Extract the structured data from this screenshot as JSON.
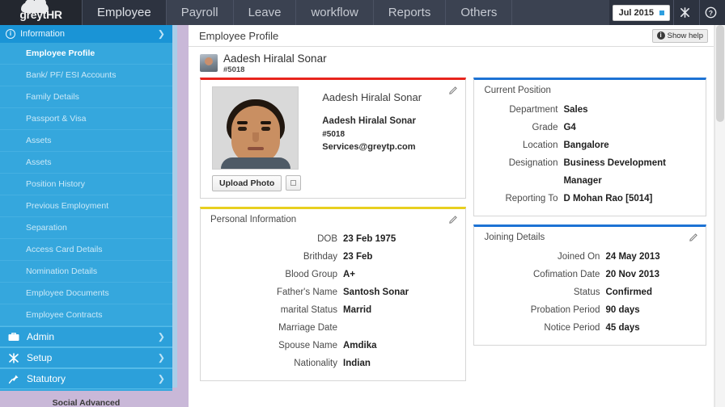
{
  "app": {
    "logo_grey": "greyt",
    "logo_hr": "HR"
  },
  "topnav": {
    "tabs": [
      {
        "label": "Employee",
        "active": true
      },
      {
        "label": "Payroll",
        "active": false
      },
      {
        "label": "Leave",
        "active": false
      },
      {
        "label": "workflow",
        "active": false
      },
      {
        "label": "Reports",
        "active": false
      },
      {
        "label": "Others",
        "active": false
      }
    ],
    "period": "Jul 2015",
    "tools_icon": "tools-icon",
    "help_icon": "help-circle-icon"
  },
  "sidebar": {
    "header": {
      "label": "Information",
      "icon": "info-circle-icon",
      "chevron": "chevron-right-icon"
    },
    "items": [
      {
        "label": "Employee Profile",
        "selected": true
      },
      {
        "label": "Bank/ PF/ ESI Accounts",
        "selected": false
      },
      {
        "label": "Family Details",
        "selected": false
      },
      {
        "label": "Passport & Visa",
        "selected": false
      },
      {
        "label": "Assets",
        "selected": false
      },
      {
        "label": "Assets",
        "selected": false
      },
      {
        "label": "Position History",
        "selected": false
      },
      {
        "label": "Previous Employment",
        "selected": false
      },
      {
        "label": "Separation",
        "selected": false
      },
      {
        "label": "Access Card Details",
        "selected": false
      },
      {
        "label": "Nomination Details",
        "selected": false
      },
      {
        "label": "Employee Documents",
        "selected": false
      },
      {
        "label": "Employee Contracts",
        "selected": false
      }
    ],
    "sections": [
      {
        "label": "Admin",
        "icon": "briefcase-icon"
      },
      {
        "label": "Setup",
        "icon": "tools-icon"
      },
      {
        "label": "Statutory",
        "icon": "pushpin-icon"
      }
    ],
    "footer": "Social Advanced"
  },
  "page": {
    "title": "Employee Profile",
    "help_button": "Show help",
    "help_icon": "info-icon"
  },
  "employee_header": {
    "name": "Aadesh Hiralal Sonar",
    "id": "#5018",
    "avatar_icon": "avatar"
  },
  "profile_card": {
    "accent_color": "#e8241c",
    "heading": "Aadesh Hiralal Sonar",
    "name": "Aadesh Hiralal Sonar",
    "id": "#5018",
    "email": "Services@greytp.com",
    "upload_button": "Upload Photo",
    "edit_icon": "pencil-icon",
    "photo_icon": "employee-photo"
  },
  "personal_information": {
    "accent_color": "#e8cf1f",
    "title": "Personal Information",
    "edit_icon": "pencil-icon",
    "rows": [
      {
        "label": "DOB",
        "value": "23 Feb 1975"
      },
      {
        "label": "Brithday",
        "value": "23 Feb"
      },
      {
        "label": "Blood Group",
        "value": "A+"
      },
      {
        "label": "Father's Name",
        "value": "Santosh Sonar"
      },
      {
        "label": "marital Status",
        "value": "Marrid"
      },
      {
        "label": "Marriage Date",
        "value": ""
      },
      {
        "label": "Spouse Name",
        "value": "Amdika"
      },
      {
        "label": "Nationality",
        "value": "Indian"
      }
    ]
  },
  "current_position": {
    "accent_color": "#1c72d4",
    "title": "Current Position",
    "rows": [
      {
        "label": "Department",
        "value": "Sales"
      },
      {
        "label": "Grade",
        "value": "G4"
      },
      {
        "label": "Location",
        "value": "Bangalore"
      },
      {
        "label": "Designation",
        "value": "Business Development Manager"
      },
      {
        "label": "Reporting To",
        "value": "D Mohan Rao [5014]"
      }
    ]
  },
  "joining_details": {
    "accent_color": "#1c72d4",
    "title": "Joining Details",
    "edit_icon": "pencil-icon",
    "rows": [
      {
        "label": "Joined On",
        "value": "24 May 2013"
      },
      {
        "label": "Cofimation Date",
        "value": "20 Nov 2013"
      },
      {
        "label": "Status",
        "value": "Confirmed"
      },
      {
        "label": "Probation Period",
        "value": "90 days"
      },
      {
        "label": "Notice Period",
        "value": "45 days"
      }
    ]
  }
}
